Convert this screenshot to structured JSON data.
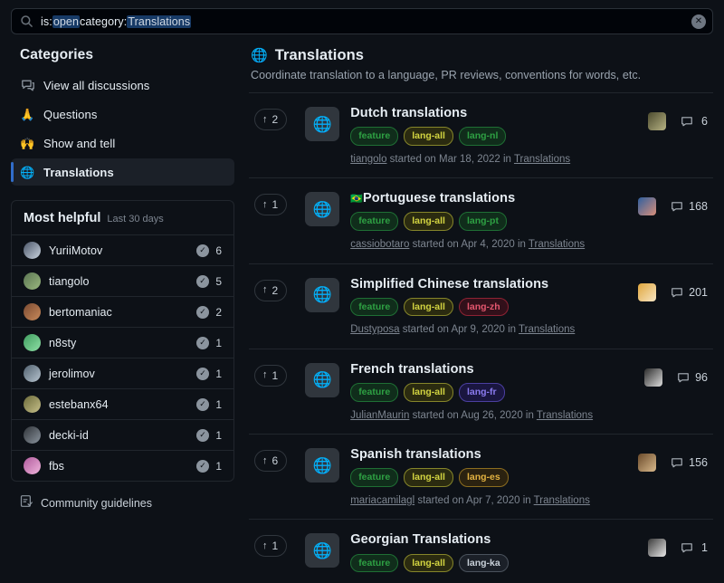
{
  "search": {
    "icon": "search-icon",
    "query_parts": [
      {
        "text": "is:",
        "kind": "key"
      },
      {
        "text": "open",
        "kind": "val"
      },
      {
        "text": " category:",
        "kind": "key"
      },
      {
        "text": "Translations",
        "kind": "val"
      }
    ],
    "full_query": "is:open category:Translations",
    "clear_label": "✕"
  },
  "sidebar": {
    "title": "Categories",
    "items": [
      {
        "label": "View all discussions",
        "icon": "discussion-icon",
        "emoji": "",
        "active": false
      },
      {
        "label": "Questions",
        "icon": "pray-emoji",
        "emoji": "🙏",
        "active": false
      },
      {
        "label": "Show and tell",
        "icon": "raised-hands-emoji",
        "emoji": "🙌",
        "active": false
      },
      {
        "label": "Translations",
        "icon": "globe-emoji",
        "emoji": "🌐",
        "active": true
      }
    ],
    "most_helpful": {
      "title": "Most helpful",
      "subtitle": "Last 30 days",
      "people": [
        {
          "name": "YuriiMotov",
          "count": "6",
          "avatar_colors": [
            "#4a5568",
            "#cbd5e0"
          ]
        },
        {
          "name": "tiangolo",
          "count": "5",
          "avatar_colors": [
            "#5b7553",
            "#9ab87e"
          ]
        },
        {
          "name": "bertomaniac",
          "count": "2",
          "avatar_colors": [
            "#7a4a32",
            "#c98a5a"
          ]
        },
        {
          "name": "n8sty",
          "count": "1",
          "avatar_colors": [
            "#3f9d5f",
            "#8fe0a6"
          ]
        },
        {
          "name": "jerolimov",
          "count": "1",
          "avatar_colors": [
            "#50606e",
            "#b7c4cf"
          ]
        },
        {
          "name": "estebanx64",
          "count": "1",
          "avatar_colors": [
            "#6b6a3a",
            "#c7c08a"
          ]
        },
        {
          "name": "decki-id",
          "count": "1",
          "avatar_colors": [
            "#2f3338",
            "#8b949e"
          ]
        },
        {
          "name": "fbs",
          "count": "1",
          "avatar_colors": [
            "#b05a9c",
            "#f0b5dd"
          ]
        }
      ],
      "check_glyph": "✓"
    },
    "guidelines": {
      "label": "Community guidelines",
      "icon": "book-check-icon"
    }
  },
  "main": {
    "emoji": "🌐",
    "title": "Translations",
    "subtitle": "Coordinate translation to a language, PR reviews, conventions for words, etc.",
    "labels_palette": {
      "feature": {
        "text": "#2ea043",
        "border": "#1f6f34",
        "bg": "#102d1b"
      },
      "lang-all": {
        "text": "#d3d441",
        "border": "#86862a",
        "bg": "#2b2b10"
      },
      "lang-nl": {
        "text": "#2ea043",
        "border": "#1f6f34",
        "bg": "#102d1b"
      },
      "lang-pt": {
        "text": "#2ea043",
        "border": "#1f6f34",
        "bg": "#102d1b"
      },
      "lang-zh": {
        "text": "#e5576f",
        "border": "#8e2233",
        "bg": "#32101a"
      },
      "lang-fr": {
        "text": "#8b7bf0",
        "border": "#4b3fa0",
        "bg": "#1a1640"
      },
      "lang-es": {
        "text": "#e3b341",
        "border": "#8c6d1f",
        "bg": "#2b2210"
      },
      "lang-ka": {
        "text": "#c9d1d9",
        "border": "#4a525c",
        "bg": "#1b2028"
      }
    },
    "discussions": [
      {
        "upvotes": "2",
        "icon_emoji": "🌐",
        "flag": "",
        "title": "Dutch translations",
        "labels": [
          "feature",
          "lang-all",
          "lang-nl"
        ],
        "author": "tiangolo",
        "meta_mid": " started on ",
        "date": "Mar 18, 2022",
        "meta_in": " in ",
        "category": "Translations",
        "comments": "6",
        "avatar_colors": [
          "#4b4a2e",
          "#b6b283"
        ]
      },
      {
        "upvotes": "1",
        "icon_emoji": "🌐",
        "flag": "🇧🇷",
        "title": "Portuguese translations",
        "labels": [
          "feature",
          "lang-all",
          "lang-pt"
        ],
        "author": "cassiobotaro",
        "meta_mid": " started on ",
        "date": "Apr 4, 2020",
        "meta_in": " in ",
        "category": "Translations",
        "comments": "168",
        "avatar_colors": [
          "#2f5f9e",
          "#d98f7a"
        ]
      },
      {
        "upvotes": "2",
        "icon_emoji": "🌐",
        "flag": "",
        "title": "Simplified Chinese translations",
        "labels": [
          "feature",
          "lang-all",
          "lang-zh"
        ],
        "author": "Dustyposa",
        "meta_mid": " started on ",
        "date": "Apr 9, 2020",
        "meta_in": " in ",
        "category": "Translations",
        "comments": "201",
        "avatar_colors": [
          "#e0a63c",
          "#f7e6c4"
        ]
      },
      {
        "upvotes": "1",
        "icon_emoji": "🌐",
        "flag": "",
        "title": "French translations",
        "labels": [
          "feature",
          "lang-all",
          "lang-fr"
        ],
        "author": "JulianMaurin",
        "meta_mid": " started on ",
        "date": "Aug 26, 2020",
        "meta_in": " in ",
        "category": "Translations",
        "comments": "96",
        "avatar_colors": [
          "#2b2b2b",
          "#dcdcdc"
        ]
      },
      {
        "upvotes": "6",
        "icon_emoji": "🌐",
        "flag": "",
        "title": "Spanish translations",
        "labels": [
          "feature",
          "lang-all",
          "lang-es"
        ],
        "author": "mariacamilagl",
        "meta_mid": " started on ",
        "date": "Apr 7, 2020",
        "meta_in": " in ",
        "category": "Translations",
        "comments": "156",
        "avatar_colors": [
          "#6a4a2a",
          "#d8b98c"
        ]
      },
      {
        "upvotes": "1",
        "icon_emoji": "🌐",
        "flag": "",
        "title": "Georgian Translations",
        "labels": [
          "feature",
          "lang-all",
          "lang-ka"
        ],
        "author": "",
        "meta_mid": "",
        "date": "",
        "meta_in": "",
        "category": "",
        "comments": "1",
        "avatar_colors": [
          "#3a3a3a",
          "#e8e8e8"
        ]
      }
    ]
  }
}
